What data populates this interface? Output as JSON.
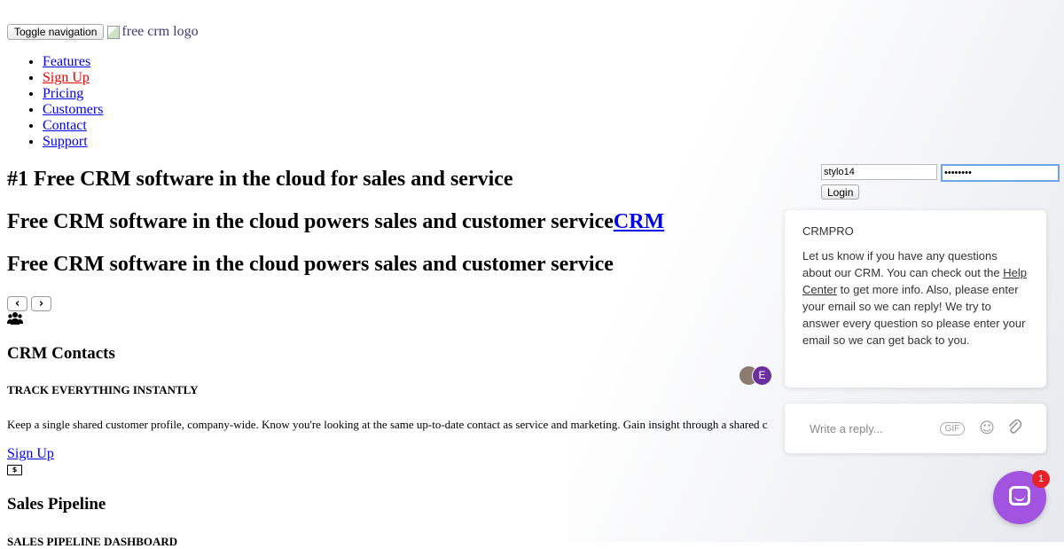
{
  "header": {
    "toggle_label": "Toggle navigation",
    "logo_alt": "free crm logo"
  },
  "nav": {
    "items": [
      {
        "label": "Features"
      },
      {
        "label": "Sign Up"
      },
      {
        "label": "Pricing"
      },
      {
        "label": "Customers"
      },
      {
        "label": "Contact"
      },
      {
        "label": "Support"
      }
    ]
  },
  "hero": {
    "heading_1": "#1 Free CRM software in the cloud for sales and service",
    "heading_2_text": "Free CRM software in the cloud powers sales and customer service",
    "heading_2_link": "CRM",
    "heading_3": "Free CRM software in the cloud powers sales and customer service"
  },
  "carousel": {
    "prev": "‹",
    "next": "›"
  },
  "features": [
    {
      "title": "CRM Contacts",
      "subhead": "TRACK EVERYTHING INSTANTLY",
      "text": "Keep a single shared customer profile, company-wide. Know you're looking at the same up-to-date contact as service and marketing. Gain insight through a shared c",
      "cta": "Sign Up"
    },
    {
      "title": "Sales Pipeline",
      "subhead": "SALES PIPELINE DASHBOARD"
    }
  ],
  "login": {
    "username": "stylo14",
    "password": "••••••••",
    "button": "Login"
  },
  "chat": {
    "sender": "CRMPRO",
    "message_part1": "Let us know if you have any questions about our CRM.  You can check out the ",
    "help_link": "Help Center",
    "message_part2": " to get more info.   Also, please enter your email so we can reply!  We try to answer every question so please enter your email so we can get back to you.",
    "avatar_letter": "E",
    "reply_placeholder": "Write a reply...",
    "gif_label": "GIF",
    "badge_count": "1"
  },
  "icons": {
    "users": "users-icon",
    "money": "money-icon",
    "emoji": "emoji-icon",
    "attach": "paperclip-icon"
  },
  "colors": {
    "link": "#0000ee",
    "active_link": "#ee0000",
    "launcher": "#a254e0",
    "badge": "#e8212a"
  }
}
